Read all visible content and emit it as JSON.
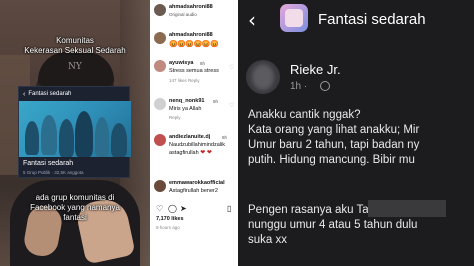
{
  "left_panel": {
    "top_caption": [
      "Komunitas",
      "Kekerasan Seksual Sedarah"
    ],
    "inner_header": "Fantasi sedarah",
    "inner_title": "Fantasi sedarah",
    "inner_subtitle": "5 Grup Publik · 32,5K anggota",
    "bottom_caption": [
      "ada grup komunitas di",
      "Facebook yang namanya",
      "fantasi"
    ]
  },
  "instagram": {
    "header": {
      "username": "ahmadsahroni88",
      "subtitle": "Original audio"
    },
    "comments": [
      {
        "username": "ahmadsahroni88",
        "emojis": "😡😡😡😡😡😡",
        "meta": "",
        "avatar_color": "#8a6a50"
      },
      {
        "username": "ayuwisya",
        "time": "8h",
        "text": [
          "Stress semua stress"
        ],
        "meta": "147 likes  Reply",
        "avatar_color": "#c08a80"
      },
      {
        "username": "nenq_nonk91",
        "time": "9h",
        "text": [
          "Miris ya Allah"
        ],
        "meta": "Reply",
        "avatar_color": "#d0d0d0"
      },
      {
        "username": "andiezlanuite.dj",
        "time": "8h",
        "text": [
          "Naudzubillahimindzalik",
          "astagfirullah"
        ],
        "meta": "",
        "avatar_color": "#c05050"
      },
      {
        "username": "emmawarokkaofficial",
        "time": "",
        "text": [
          "Astagfirullah bener2"
        ],
        "meta": "",
        "avatar_color": "#6a4a3a"
      }
    ],
    "likes": "7,170 likes",
    "date": "9 hours ago"
  },
  "group_post": {
    "group_name": "Fantasi sedarah",
    "author": "Rieke Jr.",
    "time": "1h ·",
    "lines": [
      "Anakku cantik nggak?",
      "Kata orang yang lihat anakku; Mir",
      "Umur baru 2 tahun, tapi badan ny",
      "putih. Hidung mancung. Bibir mu",
      "",
      "Pengen rasanya aku                 Tap",
      "nunggu umur 4 atau 5 tahun dulu",
      "suka xx"
    ]
  }
}
